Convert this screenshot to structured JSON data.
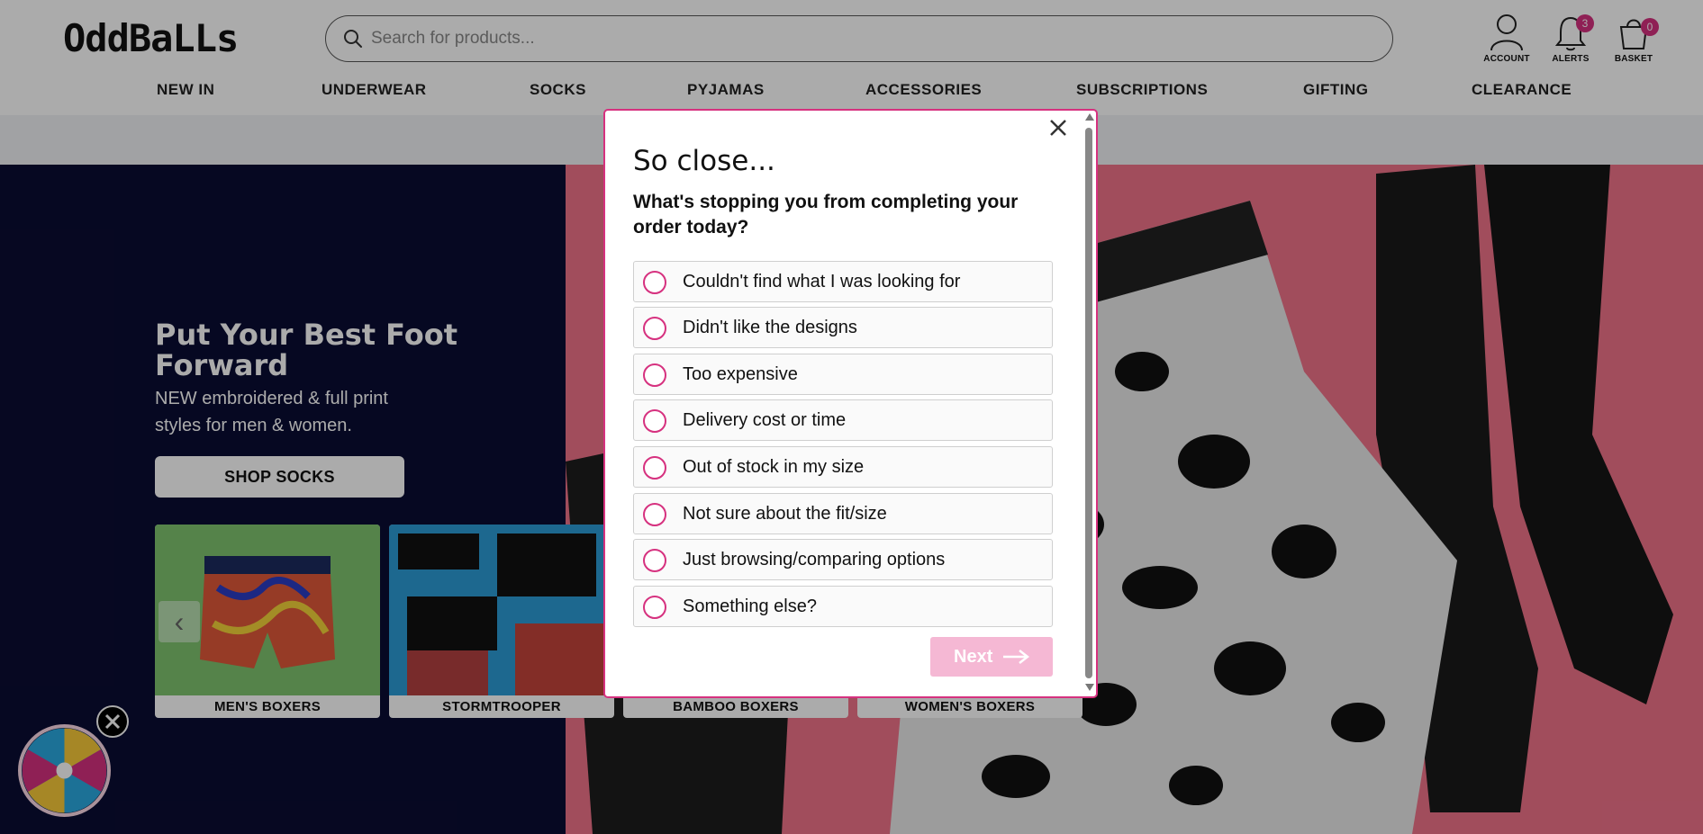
{
  "header": {
    "logo_text": "OddBaLLs",
    "search_placeholder": "Search for products...",
    "account_label": "ACCOUNT",
    "alerts_label": "ALERTS",
    "alerts_count": "3",
    "basket_label": "BASKET",
    "basket_count": "0",
    "badge_color": "#d6317f"
  },
  "nav": {
    "items": [
      {
        "label": "NEW IN"
      },
      {
        "label": "UNDERWEAR"
      },
      {
        "label": "SOCKS"
      },
      {
        "label": "PYJAMAS"
      },
      {
        "label": "ACCESSORIES"
      },
      {
        "label": "SUBSCRIPTIONS"
      },
      {
        "label": "GIFTING"
      },
      {
        "label": "CLEARANCE"
      }
    ]
  },
  "hero": {
    "title": "Put Your Best Foot Forward",
    "subtitle": "NEW embroidered & full print styles for men & women.",
    "cta_label": "SHOP SOCKS",
    "categories": [
      {
        "label": "MEN'S BOXERS"
      },
      {
        "label": "STORMTROOPER"
      },
      {
        "label": "BAMBOO BOXERS"
      },
      {
        "label": "WOMEN'S BOXERS"
      }
    ]
  },
  "modal": {
    "title": "So close...",
    "question": "What's stopping you from completing your order today?",
    "options": [
      {
        "label": "Couldn't find what I was looking for"
      },
      {
        "label": "Didn't like the designs"
      },
      {
        "label": "Too expensive"
      },
      {
        "label": "Delivery cost or time"
      },
      {
        "label": "Out of stock in my size"
      },
      {
        "label": "Not sure about the fit/size"
      },
      {
        "label": "Just browsing/comparing options"
      },
      {
        "label": "Something else?"
      }
    ],
    "next_label": "Next",
    "accent_color": "#d6317f"
  }
}
